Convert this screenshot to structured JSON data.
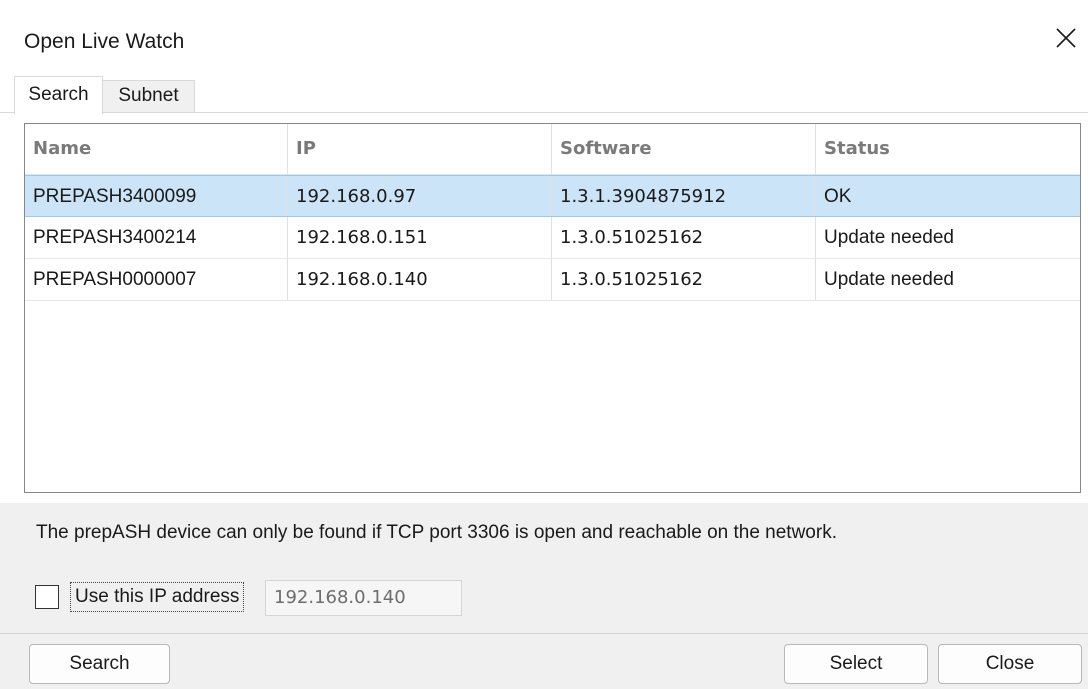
{
  "window": {
    "title": "Open Live Watch"
  },
  "tabs": [
    {
      "label": "Search",
      "active": true
    },
    {
      "label": "Subnet",
      "active": false
    }
  ],
  "table": {
    "columns": [
      "Name",
      "IP",
      "Software",
      "Status"
    ],
    "rows": [
      [
        "PREPASH3400099",
        "192.168.0.97",
        "1.3.1.3904875912",
        "OK"
      ],
      [
        "PREPASH3400214",
        "192.168.0.151",
        "1.3.0.51025162",
        "Update needed"
      ],
      [
        "PREPASH0000007",
        "192.168.0.140",
        "1.3.0.51025162",
        "Update needed"
      ]
    ],
    "selected_row": 0
  },
  "info": {
    "text": "The prepASH device can only be found if TCP port 3306 is open and reachable on the network."
  },
  "use_ip": {
    "label": "Use this IP address",
    "checked": false,
    "value": "192.168.0.140"
  },
  "buttons": {
    "search": "Search",
    "select": "Select",
    "close": "Close"
  },
  "colors": {
    "selection": "#cce4f7",
    "selection_border": "#99c9ef",
    "header_text": "#7a7a7a"
  },
  "icons": {
    "close": "close-icon"
  }
}
